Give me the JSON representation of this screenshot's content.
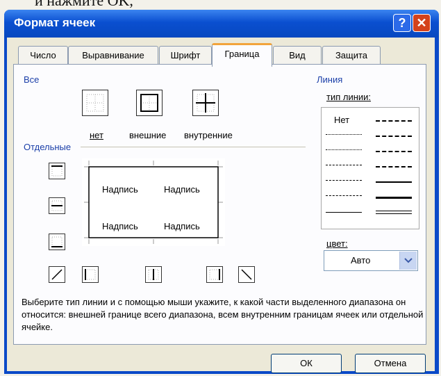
{
  "caption": "и нажмите OK,",
  "dialog": {
    "title": "Формат ячеек",
    "help_icon": "?",
    "close_icon": "✕"
  },
  "tabs": [
    "Число",
    "Выравнивание",
    "Шрифт",
    "Граница",
    "Вид",
    "Защита"
  ],
  "active_tab": "Граница",
  "all_group": {
    "label": "Все",
    "presets": [
      "нет",
      "внешние",
      "внутренние"
    ]
  },
  "separate_group": {
    "label": "Отдельные"
  },
  "preview": {
    "cells": [
      "Надпись",
      "Надпись",
      "Надпись",
      "Надпись"
    ]
  },
  "line_group": {
    "label": "Линия",
    "type_label": "тип линии:",
    "none_label": "Нет",
    "color_label": "цвет:",
    "color_value": "Авто"
  },
  "description": "Выберите тип линии и с помощью мыши укажите, к какой части выделенного диапазона он относится: внешней границе всего диапазона, всем внутренним границам ячеек или отдельной ячейке.",
  "buttons": {
    "ok": "ОК",
    "cancel": "Отмена"
  }
}
